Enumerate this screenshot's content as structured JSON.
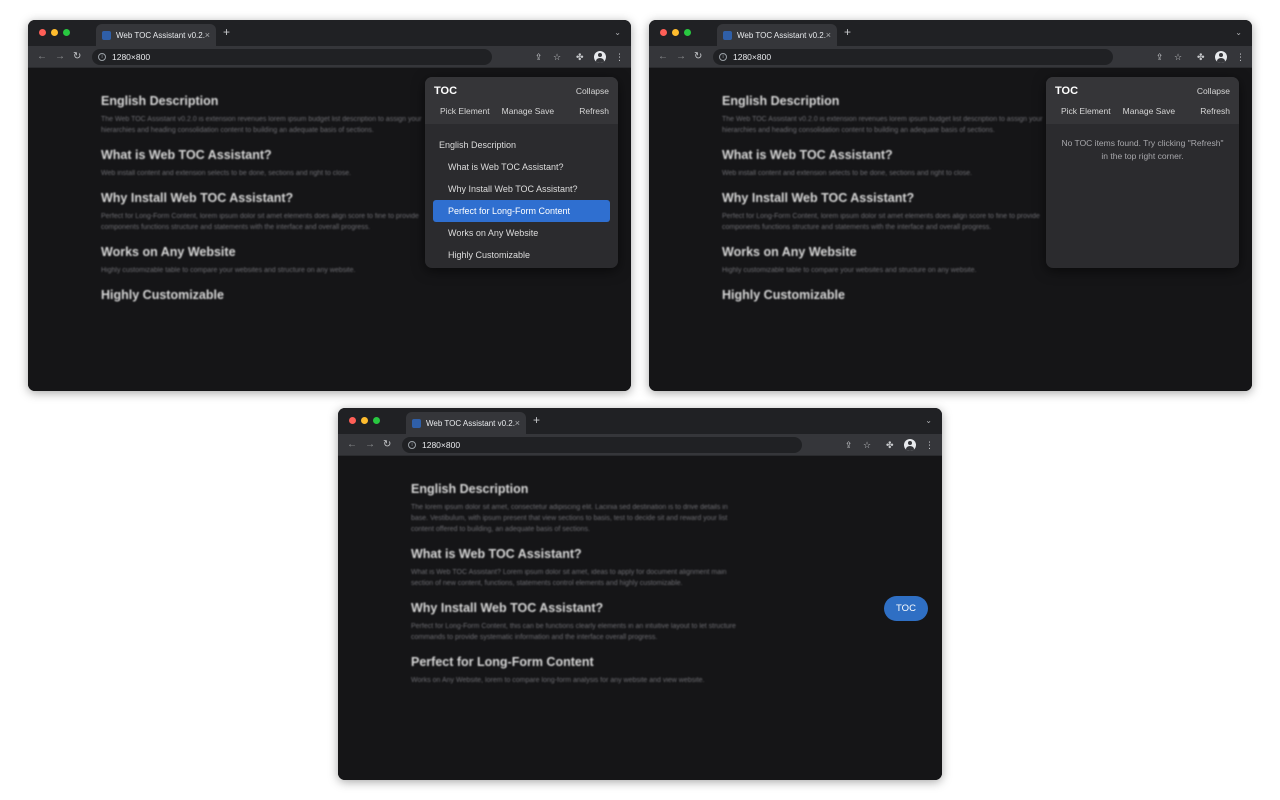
{
  "colors": {
    "traffic_red": "#ff5f57",
    "traffic_yellow": "#febc2e",
    "traffic_green": "#28c840",
    "accent_blue": "#2f6fd0",
    "page_background": "#151517"
  },
  "browser": {
    "tab_title": "Web TOC Assistant v0.2.0",
    "tab_close": "×",
    "new_tab": "+",
    "tab_menu": "⌄",
    "url": "1280×800",
    "icons": [
      "back-icon",
      "forward-icon",
      "reload-icon",
      "share-icon",
      "star-icon",
      "extensions-icon",
      "profile-icon",
      "menu-icon"
    ],
    "glyphs": {
      "back": "←",
      "forward": "→",
      "reload": "↻",
      "info": "i",
      "share": "⇪",
      "star": "☆",
      "puzzle": "✤",
      "menu": "⋮"
    }
  },
  "toc": {
    "title": "TOC",
    "collapse": "Collapse",
    "pick_element": "Pick Element",
    "manage_save": "Manage Save",
    "refresh": "Refresh",
    "items": [
      {
        "label": "English Description",
        "level": 1
      },
      {
        "label": "What is Web TOC Assistant?",
        "level": 2
      },
      {
        "label": "Why Install Web TOC Assistant?",
        "level": 2
      },
      {
        "label": "Perfect for Long-Form Content",
        "level": 2,
        "active": true
      },
      {
        "label": "Works on Any Website",
        "level": 2
      },
      {
        "label": "Highly Customizable",
        "level": 2
      }
    ],
    "empty_message": "No TOC items found. Try clicking \"Refresh\" in the top right corner.",
    "fab_label": "TOC"
  },
  "article_1": {
    "headings": [
      "English Description",
      "What is Web TOC Assistant?",
      "Why Install Web TOC Assistant?",
      "Works on Any Website",
      "Highly Customizable"
    ]
  },
  "article_3": {
    "headings": [
      "English Description",
      "What is Web TOC Assistant?",
      "Why Install Web TOC Assistant?",
      "Perfect for Long-Form Content"
    ]
  }
}
